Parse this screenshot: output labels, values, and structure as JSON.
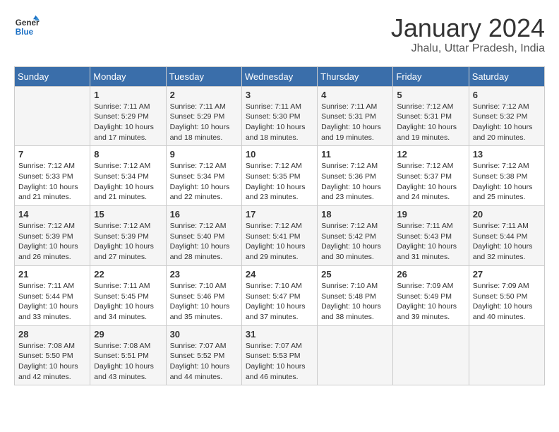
{
  "logo": {
    "text_general": "General",
    "text_blue": "Blue"
  },
  "header": {
    "title": "January 2024",
    "subtitle": "Jhalu, Uttar Pradesh, India"
  },
  "days_of_week": [
    "Sunday",
    "Monday",
    "Tuesday",
    "Wednesday",
    "Thursday",
    "Friday",
    "Saturday"
  ],
  "weeks": [
    [
      {
        "day": "",
        "info": ""
      },
      {
        "day": "1",
        "info": "Sunrise: 7:11 AM\nSunset: 5:29 PM\nDaylight: 10 hours\nand 17 minutes."
      },
      {
        "day": "2",
        "info": "Sunrise: 7:11 AM\nSunset: 5:29 PM\nDaylight: 10 hours\nand 18 minutes."
      },
      {
        "day": "3",
        "info": "Sunrise: 7:11 AM\nSunset: 5:30 PM\nDaylight: 10 hours\nand 18 minutes."
      },
      {
        "day": "4",
        "info": "Sunrise: 7:11 AM\nSunset: 5:31 PM\nDaylight: 10 hours\nand 19 minutes."
      },
      {
        "day": "5",
        "info": "Sunrise: 7:12 AM\nSunset: 5:31 PM\nDaylight: 10 hours\nand 19 minutes."
      },
      {
        "day": "6",
        "info": "Sunrise: 7:12 AM\nSunset: 5:32 PM\nDaylight: 10 hours\nand 20 minutes."
      }
    ],
    [
      {
        "day": "7",
        "info": "Sunrise: 7:12 AM\nSunset: 5:33 PM\nDaylight: 10 hours\nand 21 minutes."
      },
      {
        "day": "8",
        "info": "Sunrise: 7:12 AM\nSunset: 5:34 PM\nDaylight: 10 hours\nand 21 minutes."
      },
      {
        "day": "9",
        "info": "Sunrise: 7:12 AM\nSunset: 5:34 PM\nDaylight: 10 hours\nand 22 minutes."
      },
      {
        "day": "10",
        "info": "Sunrise: 7:12 AM\nSunset: 5:35 PM\nDaylight: 10 hours\nand 23 minutes."
      },
      {
        "day": "11",
        "info": "Sunrise: 7:12 AM\nSunset: 5:36 PM\nDaylight: 10 hours\nand 23 minutes."
      },
      {
        "day": "12",
        "info": "Sunrise: 7:12 AM\nSunset: 5:37 PM\nDaylight: 10 hours\nand 24 minutes."
      },
      {
        "day": "13",
        "info": "Sunrise: 7:12 AM\nSunset: 5:38 PM\nDaylight: 10 hours\nand 25 minutes."
      }
    ],
    [
      {
        "day": "14",
        "info": "Sunrise: 7:12 AM\nSunset: 5:39 PM\nDaylight: 10 hours\nand 26 minutes."
      },
      {
        "day": "15",
        "info": "Sunrise: 7:12 AM\nSunset: 5:39 PM\nDaylight: 10 hours\nand 27 minutes."
      },
      {
        "day": "16",
        "info": "Sunrise: 7:12 AM\nSunset: 5:40 PM\nDaylight: 10 hours\nand 28 minutes."
      },
      {
        "day": "17",
        "info": "Sunrise: 7:12 AM\nSunset: 5:41 PM\nDaylight: 10 hours\nand 29 minutes."
      },
      {
        "day": "18",
        "info": "Sunrise: 7:12 AM\nSunset: 5:42 PM\nDaylight: 10 hours\nand 30 minutes."
      },
      {
        "day": "19",
        "info": "Sunrise: 7:11 AM\nSunset: 5:43 PM\nDaylight: 10 hours\nand 31 minutes."
      },
      {
        "day": "20",
        "info": "Sunrise: 7:11 AM\nSunset: 5:44 PM\nDaylight: 10 hours\nand 32 minutes."
      }
    ],
    [
      {
        "day": "21",
        "info": "Sunrise: 7:11 AM\nSunset: 5:44 PM\nDaylight: 10 hours\nand 33 minutes."
      },
      {
        "day": "22",
        "info": "Sunrise: 7:11 AM\nSunset: 5:45 PM\nDaylight: 10 hours\nand 34 minutes."
      },
      {
        "day": "23",
        "info": "Sunrise: 7:10 AM\nSunset: 5:46 PM\nDaylight: 10 hours\nand 35 minutes."
      },
      {
        "day": "24",
        "info": "Sunrise: 7:10 AM\nSunset: 5:47 PM\nDaylight: 10 hours\nand 37 minutes."
      },
      {
        "day": "25",
        "info": "Sunrise: 7:10 AM\nSunset: 5:48 PM\nDaylight: 10 hours\nand 38 minutes."
      },
      {
        "day": "26",
        "info": "Sunrise: 7:09 AM\nSunset: 5:49 PM\nDaylight: 10 hours\nand 39 minutes."
      },
      {
        "day": "27",
        "info": "Sunrise: 7:09 AM\nSunset: 5:50 PM\nDaylight: 10 hours\nand 40 minutes."
      }
    ],
    [
      {
        "day": "28",
        "info": "Sunrise: 7:08 AM\nSunset: 5:50 PM\nDaylight: 10 hours\nand 42 minutes."
      },
      {
        "day": "29",
        "info": "Sunrise: 7:08 AM\nSunset: 5:51 PM\nDaylight: 10 hours\nand 43 minutes."
      },
      {
        "day": "30",
        "info": "Sunrise: 7:07 AM\nSunset: 5:52 PM\nDaylight: 10 hours\nand 44 minutes."
      },
      {
        "day": "31",
        "info": "Sunrise: 7:07 AM\nSunset: 5:53 PM\nDaylight: 10 hours\nand 46 minutes."
      },
      {
        "day": "",
        "info": ""
      },
      {
        "day": "",
        "info": ""
      },
      {
        "day": "",
        "info": ""
      }
    ]
  ]
}
